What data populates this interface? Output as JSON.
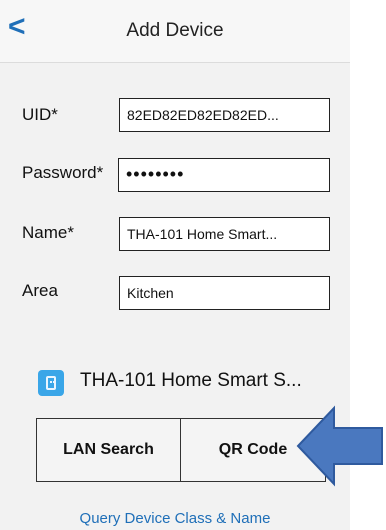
{
  "header": {
    "back_label": "<",
    "title": "Add Device"
  },
  "form": {
    "uid_label": "UID*",
    "uid_value": "82ED82ED82ED82ED...",
    "password_label": "Password*",
    "password_value": "••••••••",
    "name_label": "Name*",
    "name_value": "THA-101 Home Smart...",
    "area_label": "Area",
    "area_value": "Kitchen"
  },
  "device": {
    "icon": "device-icon",
    "name": "THA-101 Home Smart S..."
  },
  "buttons": {
    "lan_search": "LAN Search",
    "qr_code": "QR Code"
  },
  "links": {
    "query": "Query Device Class & Name"
  },
  "colors": {
    "accent": "#1f6fb8",
    "arrow": "#4a78bf",
    "device_icon": "#3aa6e8"
  }
}
